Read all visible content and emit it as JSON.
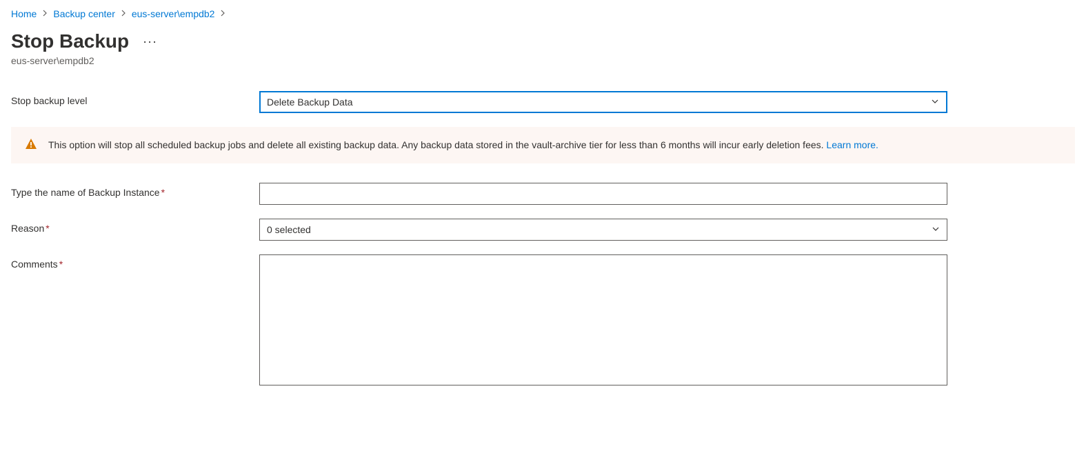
{
  "breadcrumb": {
    "items": [
      {
        "label": "Home"
      },
      {
        "label": "Backup center"
      },
      {
        "label": "eus-server\\empdb2"
      }
    ]
  },
  "header": {
    "title": "Stop Backup",
    "more": "···",
    "subtitle": "eus-server\\empdb2"
  },
  "form": {
    "stopLevel": {
      "label": "Stop backup level",
      "value": "Delete Backup Data"
    },
    "warning": {
      "text": "This option will stop all scheduled backup jobs and delete all existing backup data. Any backup data stored in the vault-archive tier for less than 6 months will incur early deletion fees. ",
      "link": "Learn more."
    },
    "instanceName": {
      "label": "Type the name of Backup Instance",
      "value": ""
    },
    "reason": {
      "label": "Reason",
      "value": "0 selected"
    },
    "comments": {
      "label": "Comments",
      "value": ""
    }
  }
}
